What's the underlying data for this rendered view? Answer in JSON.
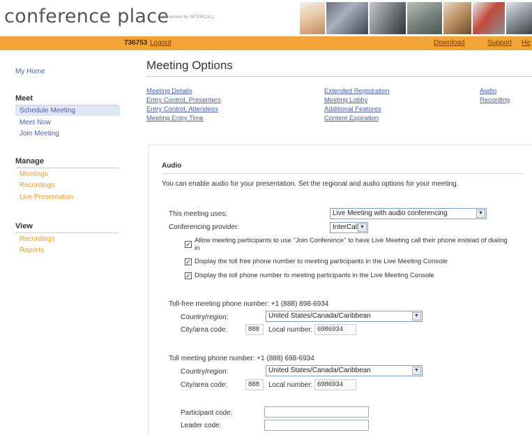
{
  "header": {
    "logo": "conference place",
    "presented_by": "presented by INTERCALL"
  },
  "topbar": {
    "meeting_id": "736753",
    "logout": "Logout",
    "download": "Download",
    "support": "Support",
    "help": "He"
  },
  "sidebar": {
    "home": "My Home",
    "meet": {
      "title": "Meet",
      "items": [
        "Schedule Meeting",
        "Meet Now",
        "Join Meeting"
      ]
    },
    "manage": {
      "title": "Manage",
      "items": [
        "Meetings",
        "Recordings",
        "Live Presentation"
      ]
    },
    "view": {
      "title": "View",
      "items": [
        "Recordings",
        "Reports"
      ]
    }
  },
  "main": {
    "title": "Meeting Options",
    "tabs_col1": [
      "Meeting Details",
      "Entry Control, Presenters",
      "Entry Control, Attendees",
      "Meeting Entry Time"
    ],
    "tabs_col2": [
      "Extended Registration",
      "Meeting Lobby",
      "Additional Features",
      "Content Expiration"
    ],
    "tabs_col3": [
      "Audio",
      "Recording"
    ]
  },
  "audio": {
    "title": "Audio",
    "intro": "You can enable audio for your presentation. Set the regional and audio options for your meeting.",
    "uses_label": "This meeting uses:",
    "uses_value": "Live Meeting with audio conferencing",
    "provider_label": "Conferencing provider:",
    "provider_value": "InterCall",
    "checkboxes": [
      {
        "label": "Allow meeting participants to use \"Join Conference\" to have Live Meeting call their phone instead of dialing in",
        "checked": true
      },
      {
        "label": "Display the toll free phone number to meeting participants in the Live Meeting Console",
        "checked": true
      },
      {
        "label": "Display the toll phone number to meeting participants in the Live Meeting Console",
        "checked": true
      }
    ],
    "tollfree": {
      "heading": "Toll-free meeting phone number: +1 (888) 898-6934",
      "country_label": "Country/region:",
      "country_value": "United States/Canada/Caribbean",
      "area_label": "City/area code:",
      "area_value": "888",
      "local_label": "Local number:",
      "local_value": "6986934"
    },
    "toll": {
      "heading": "Toll meeting phone number: +1 (888) 698-6934",
      "country_label": "Country/region:",
      "country_value": "United States/Canada/Caribbean",
      "area_label": "City/area code:",
      "area_value": "888",
      "local_label": "Local number:",
      "local_value": "6986934"
    },
    "participant_label": "Participant code:",
    "participant_value": "",
    "leader_label": "Leader code:",
    "leader_value": ""
  },
  "colors": {
    "accent_orange": "#f4a338",
    "link_blue": "#4a5fa5",
    "selected_bg": "#dfe7f7"
  }
}
